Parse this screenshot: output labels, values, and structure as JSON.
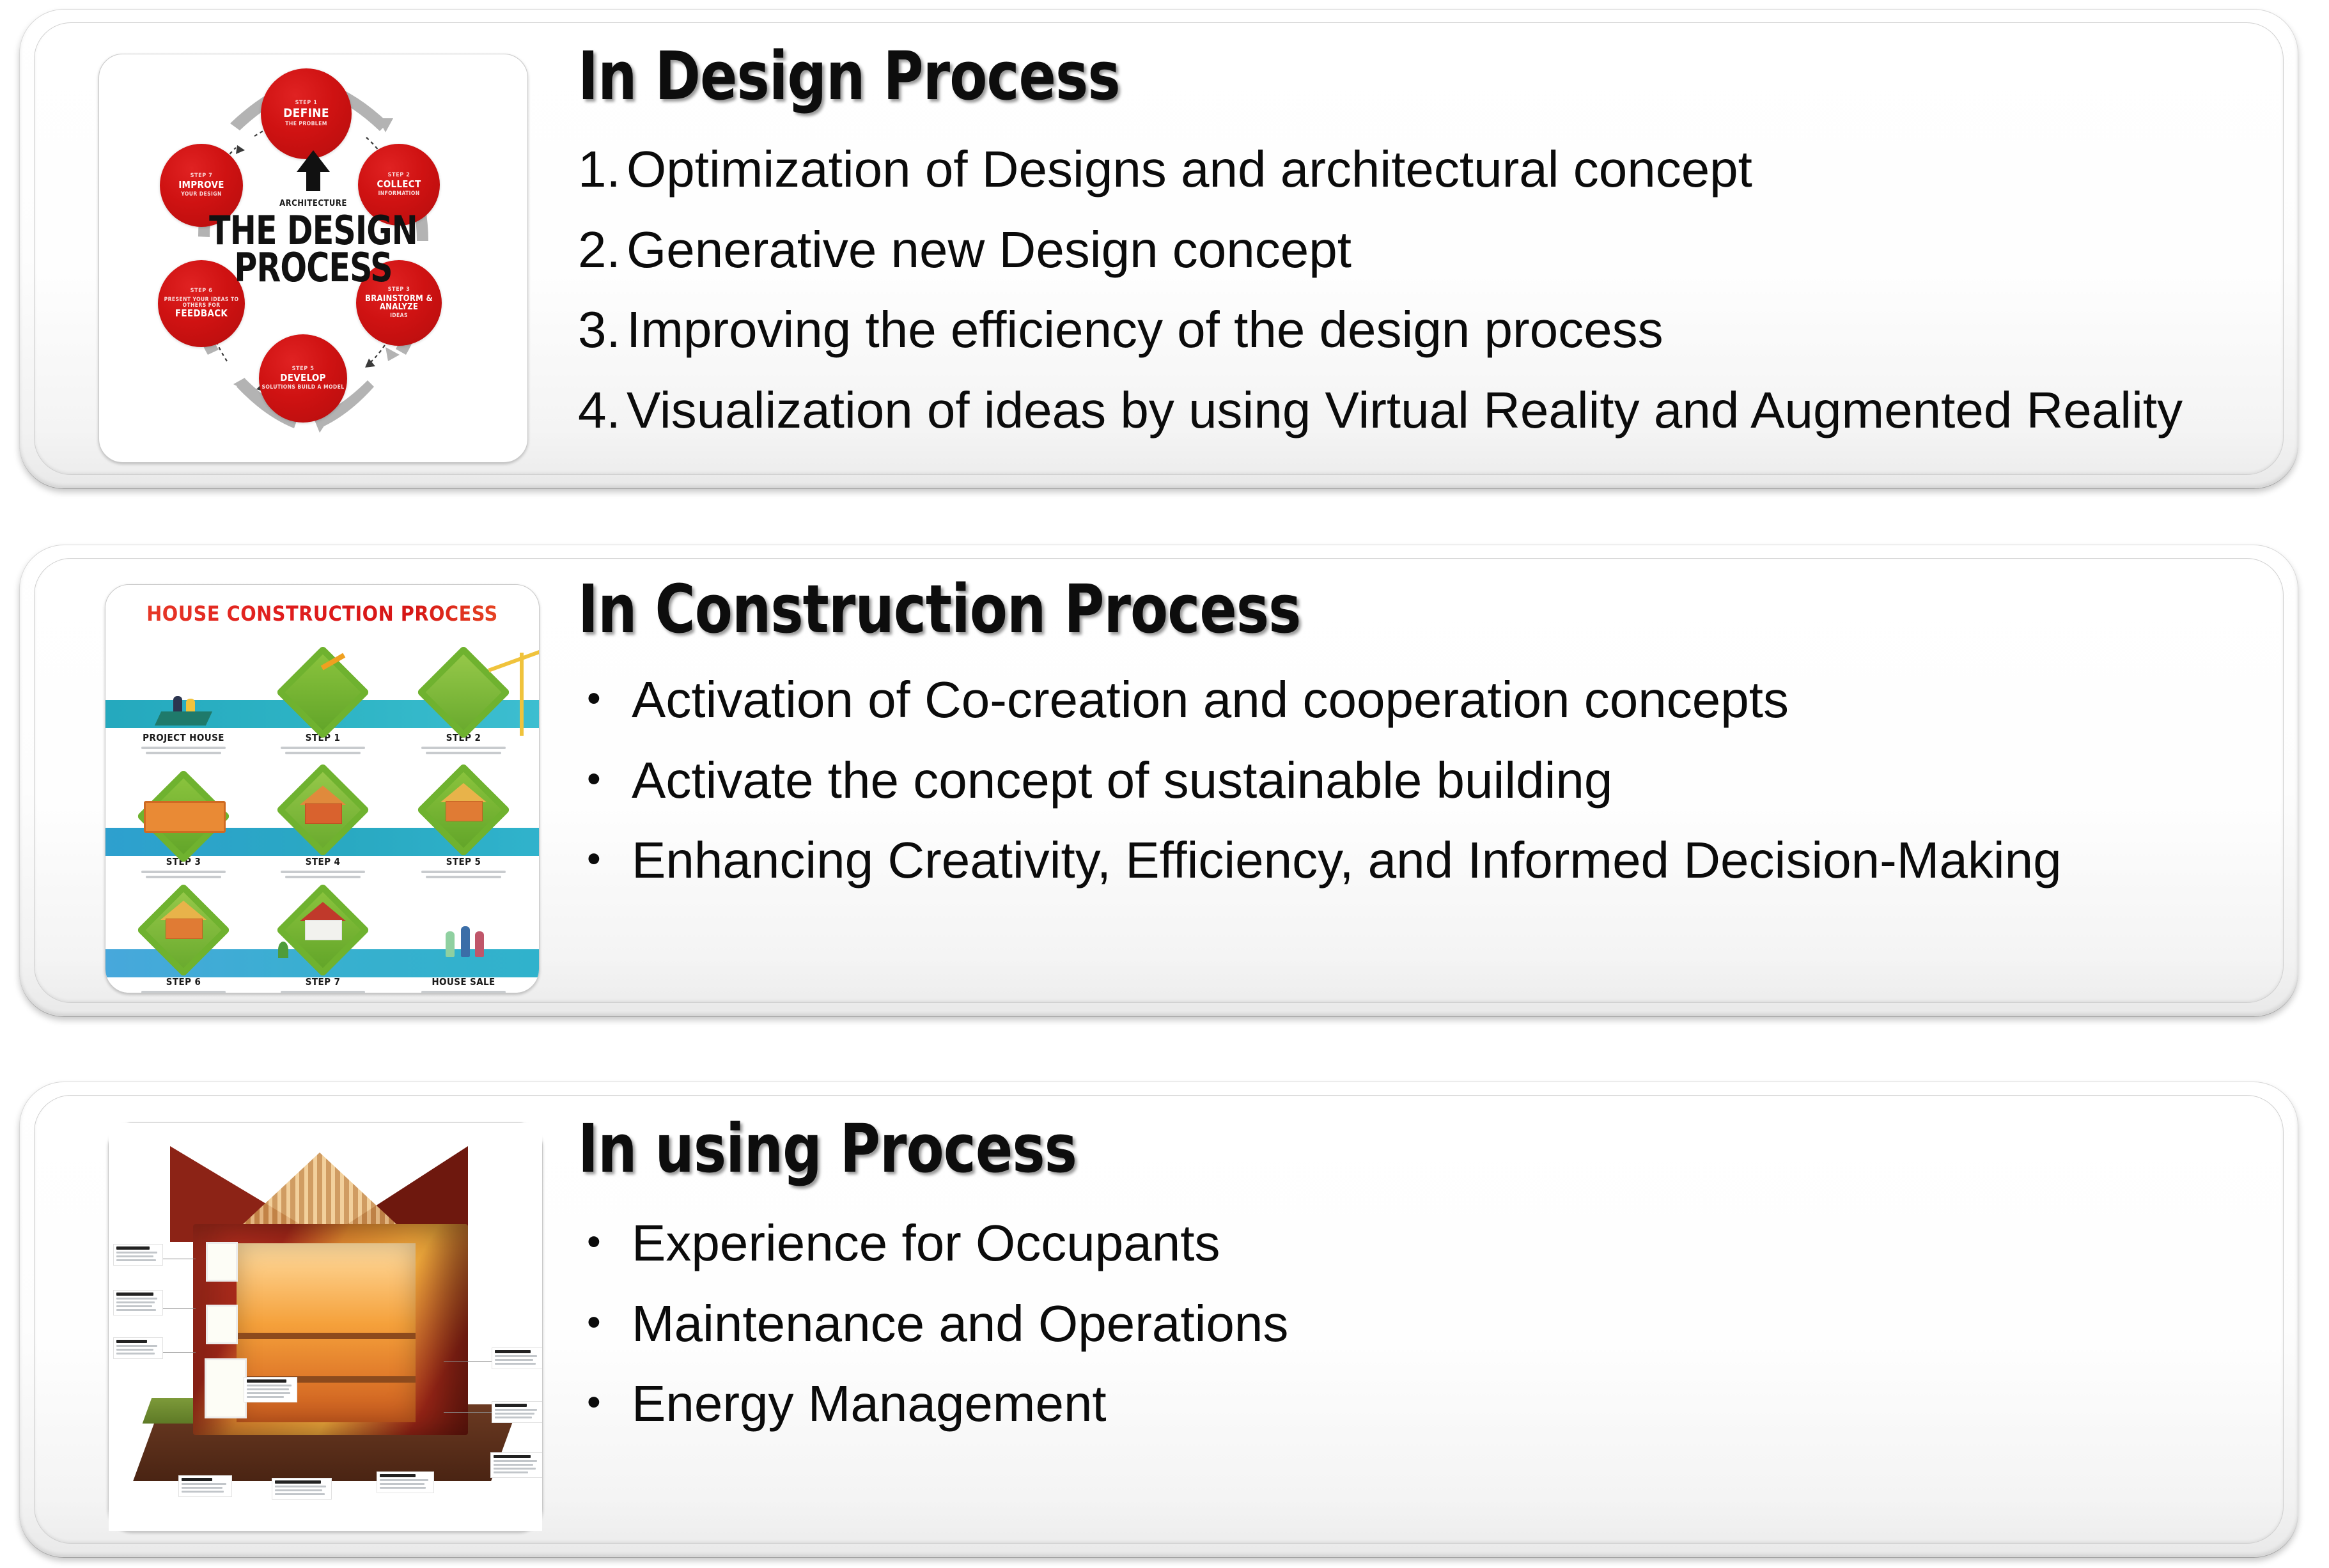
{
  "cards": [
    {
      "id": "design",
      "heading": "In Design Process",
      "list_style": "numbered",
      "items": [
        {
          "marker": "1.",
          "text": "Optimization of Designs and architectural concept"
        },
        {
          "marker": "2.",
          "text": "Generative new Design concept"
        },
        {
          "marker": "3.",
          "text": "Improving the efficiency of the design process"
        },
        {
          "marker": "4.",
          "text": "Visualization of ideas by using Virtual Reality and Augmented Reality"
        }
      ],
      "image": {
        "name": "the-design-process-wheel",
        "title_line_1": "THE DESIGN",
        "title_line_2": "PROCESS",
        "brand": "ARCHITECTURE",
        "accent_color": "#cf1212",
        "steps": [
          {
            "step": "STEP 1",
            "main": "DEFINE",
            "sub": "THE PROBLEM"
          },
          {
            "step": "STEP 2",
            "main": "COLLECT",
            "sub": "INFORMATION"
          },
          {
            "step": "STEP 3",
            "main": "BRAINSTORM & ANALYZE",
            "sub": "IDEAS"
          },
          {
            "step": "STEP 5",
            "main": "DEVELOP",
            "sub": "SOLUTIONS BUILD A MODEL"
          },
          {
            "step": "STEP 6",
            "main": "FEEDBACK",
            "sub": "PRESENT YOUR IDEAS TO OTHERS FOR"
          },
          {
            "step": "STEP 7",
            "main": "IMPROVE",
            "sub": "YOUR DESIGN"
          }
        ]
      }
    },
    {
      "id": "construction",
      "heading": "In Construction Process",
      "list_style": "bulleted",
      "items": [
        {
          "marker": "•",
          "text": "Activation of Co-creation and cooperation concepts"
        },
        {
          "marker": "•",
          "text": "Activate the concept of sustainable building"
        },
        {
          "marker": "•",
          "text": "Enhancing Creativity, Efficiency, and Informed Decision-Making"
        }
      ],
      "image": {
        "name": "house-construction-process-infographic",
        "title": "HOUSE CONSTRUCTION PROCESS",
        "title_color": "#e01d1d",
        "band_color": "#2fb5c6",
        "steps": [
          "PROJECT HOUSE",
          "STEP 1",
          "STEP 2",
          "STEP 3",
          "STEP 4",
          "STEP 5",
          "STEP 6",
          "STEP 7",
          "HOUSE SALE"
        ]
      }
    },
    {
      "id": "using",
      "heading": "In using Process",
      "list_style": "bulleted",
      "items": [
        {
          "marker": "•",
          "text": "Experience for Occupants"
        },
        {
          "marker": "•",
          "text": "Maintenance and Operations"
        },
        {
          "marker": "•",
          "text": "Energy Management"
        }
      ],
      "image": {
        "name": "cutaway-house-illustration",
        "description": "Cross-section cutaway of a brick house with labelled callouts"
      }
    }
  ]
}
